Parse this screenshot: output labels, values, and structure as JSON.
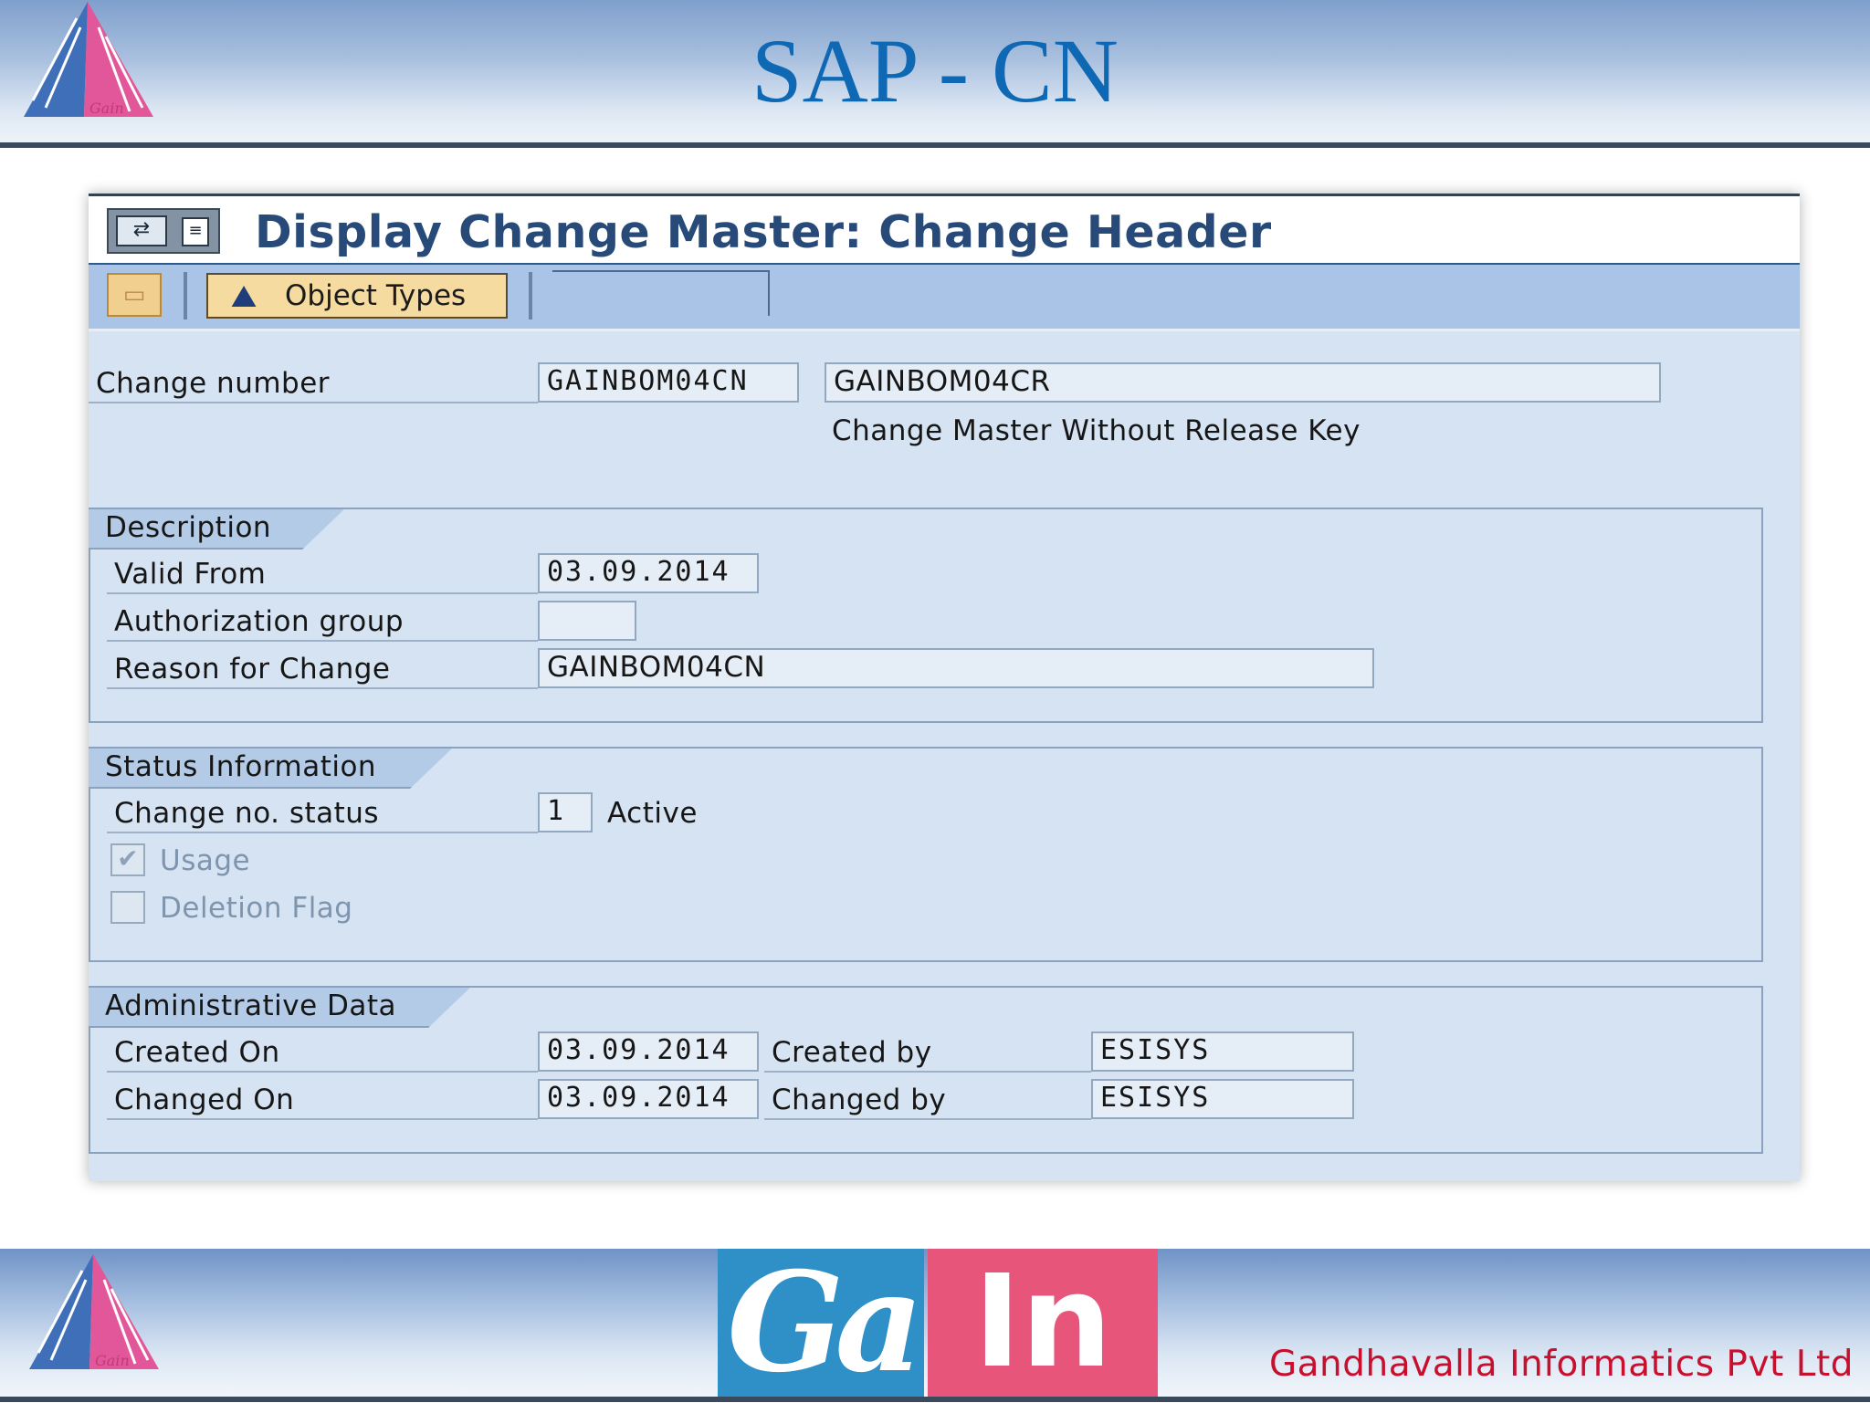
{
  "slide": {
    "title": "SAP - CN",
    "logo_text": "Gain",
    "footer_brand_left": "Ga",
    "footer_brand_right": "In",
    "company": "Gandhavalla Informatics Pvt Ltd"
  },
  "window": {
    "title": "Display Change Master: Change Header"
  },
  "toolbar": {
    "object_types_label": "Object Types"
  },
  "header": {
    "change_number_label": "Change number",
    "change_number_value": "GAINBOM04CN",
    "description_value": "GAINBOM04CR",
    "type_text": "Change Master Without Release Key"
  },
  "description_group": {
    "title": "Description",
    "valid_from_label": "Valid From",
    "valid_from_value": "03.09.2014",
    "auth_group_label": "Authorization group",
    "auth_group_value": "",
    "reason_label": "Reason for Change",
    "reason_value": "GAINBOM04CN"
  },
  "status_group": {
    "title": "Status Information",
    "status_label": "Change no. status",
    "status_value": "1",
    "status_text": "Active",
    "usage_label": "Usage",
    "usage_checked": true,
    "deletion_label": "Deletion Flag",
    "deletion_checked": false
  },
  "admin_group": {
    "title": "Administrative Data",
    "created_on_label": "Created On",
    "created_on_value": "03.09.2014",
    "created_by_label": "Created by",
    "created_by_value": "ESISYS",
    "changed_on_label": "Changed On",
    "changed_on_value": "03.09.2014",
    "changed_by_label": "Changed by",
    "changed_by_value": "ESISYS"
  },
  "colors": {
    "slide_title": "#0f68b4",
    "window_title": "#274a79",
    "window_bg": "#d5e3f2",
    "company": "#c8102e",
    "brand_blue": "#2f8fc7",
    "brand_pink": "#e8557a"
  }
}
